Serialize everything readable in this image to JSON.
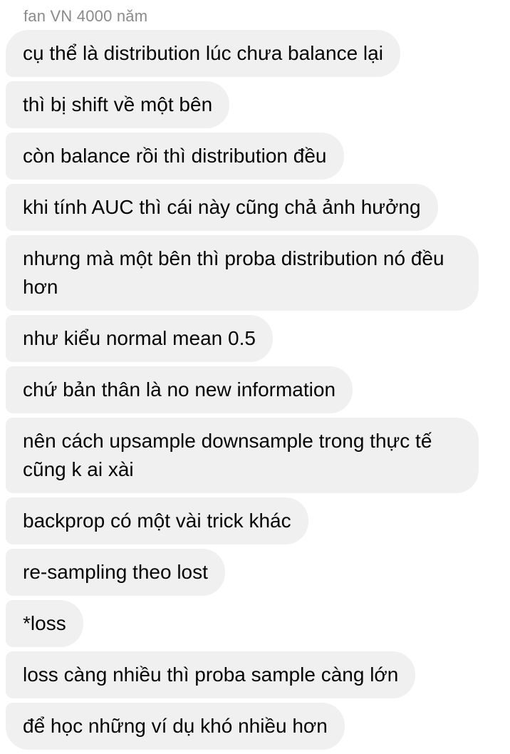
{
  "sender": {
    "name": "fan VN 4000 năm"
  },
  "messages": [
    {
      "text": "cụ thể là distribution lúc chưa balance lại"
    },
    {
      "text": "thì bị shift về một bên"
    },
    {
      "text": "còn balance rồi thì distribution đều"
    },
    {
      "text": "khi tính AUC thì cái này cũng chả ảnh hưởng"
    },
    {
      "text": "nhưng mà một bên thì proba distribution nó đều hơn"
    },
    {
      "text": "như kiểu normal mean 0.5"
    },
    {
      "text": "chứ bản thân là no new information"
    },
    {
      "text": "nên cách upsample downsample trong thực tế cũng k ai xài"
    },
    {
      "text": "backprop có một vài trick khác"
    },
    {
      "text": "re-sampling theo lost"
    },
    {
      "text": "*loss"
    },
    {
      "text": "loss càng nhiều thì proba sample càng lớn"
    },
    {
      "text": "để học những ví dụ khó nhiều hơn"
    }
  ],
  "colors": {
    "bubble_background": "#f0f0f0",
    "message_text": "#050505",
    "sender_text": "#8a8a8d"
  }
}
